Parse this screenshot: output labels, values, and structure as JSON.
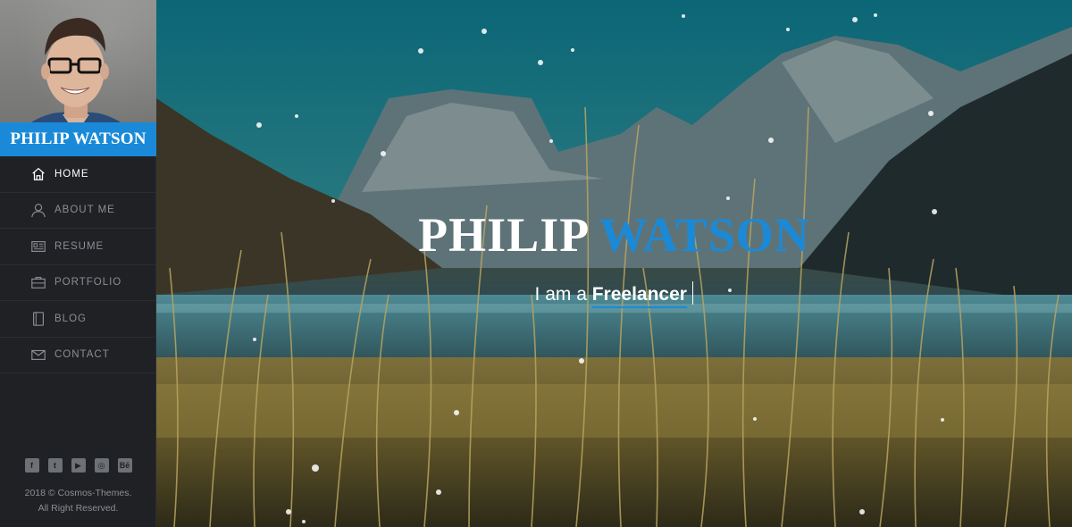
{
  "profile": {
    "name": "PHILIP WATSON"
  },
  "nav": {
    "items": [
      {
        "label": "HOME",
        "icon": "home-icon",
        "active": true
      },
      {
        "label": "ABOUT ME",
        "icon": "user-icon",
        "active": false
      },
      {
        "label": "RESUME",
        "icon": "resume-icon",
        "active": false
      },
      {
        "label": "PORTFOLIO",
        "icon": "briefcase-icon",
        "active": false
      },
      {
        "label": "BLOG",
        "icon": "book-icon",
        "active": false
      },
      {
        "label": "CONTACT",
        "icon": "mail-icon",
        "active": false
      }
    ]
  },
  "socials": [
    {
      "icon": "facebook-icon",
      "glyph": "f"
    },
    {
      "icon": "twitter-icon",
      "glyph": "t"
    },
    {
      "icon": "youtube-icon",
      "glyph": "▶"
    },
    {
      "icon": "dribbble-icon",
      "glyph": "◎"
    },
    {
      "icon": "behance-icon",
      "glyph": "Bē"
    }
  ],
  "footer": {
    "line1": "2018 © Cosmos-Themes.",
    "line2": "All Right Reserved."
  },
  "hero": {
    "first_name": "PHILIP",
    "last_name": "WATSON",
    "tagline_prefix": "I am a",
    "tagline_role": "Freelancer"
  },
  "colors": {
    "accent": "#1a8ad8",
    "sidebar_bg": "#1f2125",
    "nav_text": "#8b8e93"
  }
}
